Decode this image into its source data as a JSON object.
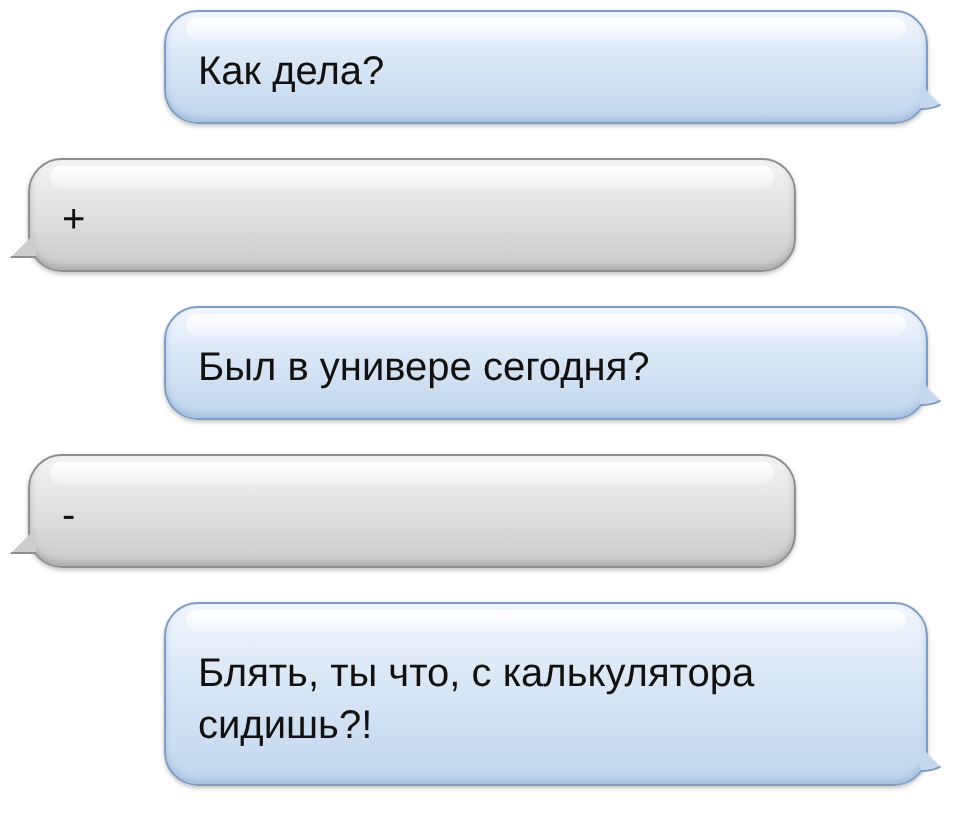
{
  "messages": [
    {
      "kind": "outgoing",
      "text": "Как дела?"
    },
    {
      "kind": "incoming",
      "text": "+"
    },
    {
      "kind": "outgoing",
      "text": "Был в универе сегодня?"
    },
    {
      "kind": "incoming",
      "text": "-"
    },
    {
      "kind": "outgoing",
      "text": "Блять, ты что, с калькулятора сидишь?!"
    }
  ]
}
